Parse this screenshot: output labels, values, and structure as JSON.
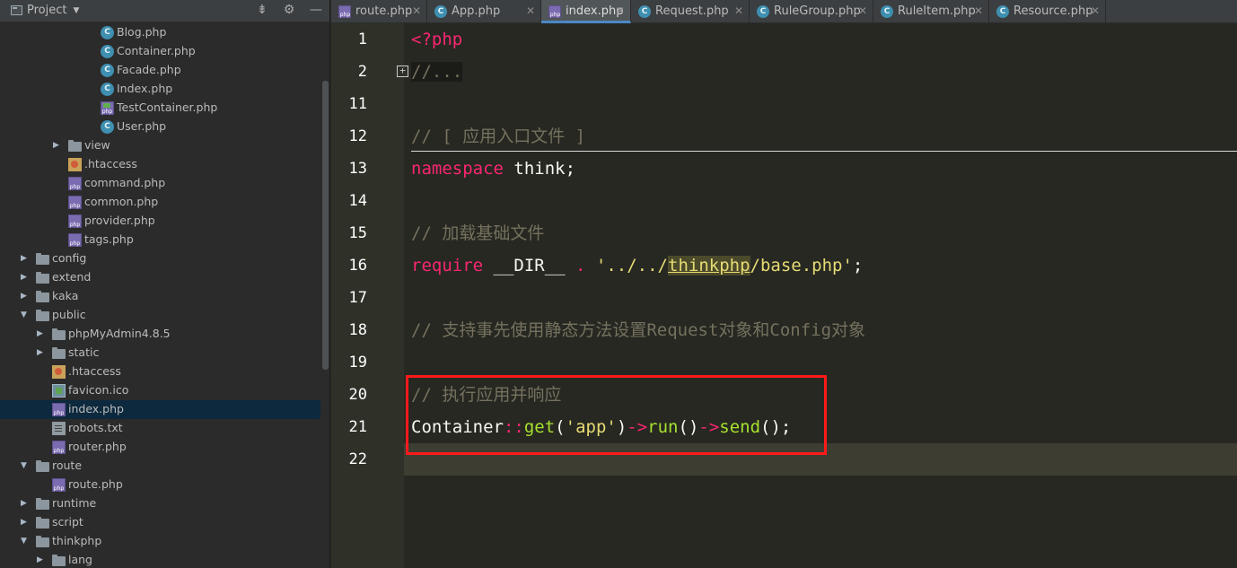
{
  "project_panel": {
    "title": "Project",
    "tree": [
      {
        "label": "Blog.php",
        "icon": "class",
        "depth": 4
      },
      {
        "label": "Container.php",
        "icon": "class",
        "depth": 4
      },
      {
        "label": "Facade.php",
        "icon": "class",
        "depth": 4
      },
      {
        "label": "Index.php",
        "icon": "class",
        "depth": 4
      },
      {
        "label": "TestContainer.php",
        "icon": "test",
        "depth": 4
      },
      {
        "label": "User.php",
        "icon": "class",
        "depth": 4
      },
      {
        "label": "view",
        "icon": "folder",
        "depth": 2,
        "arrow": "collapsed"
      },
      {
        "label": ".htaccess",
        "icon": "htaccess",
        "depth": 2
      },
      {
        "label": "command.php",
        "icon": "php",
        "depth": 2
      },
      {
        "label": "common.php",
        "icon": "php",
        "depth": 2
      },
      {
        "label": "provider.php",
        "icon": "php",
        "depth": 2
      },
      {
        "label": "tags.php",
        "icon": "php",
        "depth": 2
      },
      {
        "label": "config",
        "icon": "folder",
        "depth": 0,
        "arrow": "collapsed"
      },
      {
        "label": "extend",
        "icon": "folder",
        "depth": 0,
        "arrow": "collapsed"
      },
      {
        "label": "kaka",
        "icon": "folder",
        "depth": 0,
        "arrow": "collapsed"
      },
      {
        "label": "public",
        "icon": "folder",
        "depth": 0,
        "arrow": "expanded"
      },
      {
        "label": "phpMyAdmin4.8.5",
        "icon": "folder",
        "depth": 1,
        "arrow": "collapsed"
      },
      {
        "label": "static",
        "icon": "folder",
        "depth": 1,
        "arrow": "collapsed"
      },
      {
        "label": ".htaccess",
        "icon": "htaccess",
        "depth": 1
      },
      {
        "label": "favicon.ico",
        "icon": "ico",
        "depth": 1
      },
      {
        "label": "index.php",
        "icon": "php",
        "depth": 1,
        "selected": true
      },
      {
        "label": "robots.txt",
        "icon": "txt",
        "depth": 1
      },
      {
        "label": "router.php",
        "icon": "php",
        "depth": 1
      },
      {
        "label": "route",
        "icon": "folder",
        "depth": 0,
        "arrow": "expanded"
      },
      {
        "label": "route.php",
        "icon": "php",
        "depth": 1
      },
      {
        "label": "runtime",
        "icon": "folder",
        "depth": 0,
        "arrow": "collapsed"
      },
      {
        "label": "script",
        "icon": "folder",
        "depth": 0,
        "arrow": "collapsed"
      },
      {
        "label": "thinkphp",
        "icon": "folder",
        "depth": 0,
        "arrow": "expanded"
      },
      {
        "label": "lang",
        "icon": "folder",
        "depth": 1,
        "arrow": "collapsed"
      }
    ]
  },
  "tabs": [
    {
      "label": "route.php",
      "icon": "php",
      "active": false
    },
    {
      "label": "App.php",
      "icon": "class",
      "active": false
    },
    {
      "label": "index.php",
      "icon": "php",
      "active": true
    },
    {
      "label": "Request.php",
      "icon": "class",
      "active": false
    },
    {
      "label": "RuleGroup.php",
      "icon": "class",
      "active": false
    },
    {
      "label": "RuleItem.php",
      "icon": "class",
      "active": false
    },
    {
      "label": "Resource.php",
      "icon": "class",
      "active": false
    }
  ],
  "editor": {
    "line_numbers": [
      "1",
      "2",
      "11",
      "12",
      "13",
      "14",
      "15",
      "16",
      "17",
      "18",
      "19",
      "20",
      "21",
      "22"
    ],
    "current_line": "22",
    "code": [
      [
        {
          "t": "<?php",
          "c": "kw"
        }
      ],
      [
        {
          "t": "//...",
          "c": "fold-text"
        }
      ],
      [],
      [
        {
          "t": "// [ 应用入口文件 ]",
          "c": "cm"
        }
      ],
      [
        {
          "t": "namespace",
          "c": "kw"
        },
        {
          "t": " think;",
          "c": "plain"
        }
      ],
      [],
      [
        {
          "t": "// 加载基础文件",
          "c": "cm"
        }
      ],
      [
        {
          "t": "require",
          "c": "kw"
        },
        {
          "t": " __DIR__ ",
          "c": "plain"
        },
        {
          "t": ".",
          "c": "op"
        },
        {
          "t": " '../../",
          "c": "str"
        },
        {
          "t": "thinkphp",
          "c": "hl-word"
        },
        {
          "t": "/base.php'",
          "c": "str"
        },
        {
          "t": ";",
          "c": "plain"
        }
      ],
      [],
      [
        {
          "t": "// 支持事先使用静态方法设置Request对象和Config对象",
          "c": "cm"
        }
      ],
      [],
      [
        {
          "t": "// 执行应用并响应",
          "c": "cm"
        }
      ],
      [
        {
          "t": "Container",
          "c": "plain"
        },
        {
          "t": "::",
          "c": "op"
        },
        {
          "t": "get",
          "c": "fn"
        },
        {
          "t": "(",
          "c": "plain"
        },
        {
          "t": "'app'",
          "c": "str"
        },
        {
          "t": ")",
          "c": "plain"
        },
        {
          "t": "->",
          "c": "op"
        },
        {
          "t": "run",
          "c": "fn"
        },
        {
          "t": "()",
          "c": "plain"
        },
        {
          "t": "->",
          "c": "op"
        },
        {
          "t": "send",
          "c": "fn"
        },
        {
          "t": "();",
          "c": "plain"
        }
      ],
      []
    ]
  },
  "icons": {
    "header_tools": [
      "collapse-all-icon",
      "gear-icon",
      "minimize-icon"
    ],
    "close": "close-icon"
  },
  "colors": {
    "highlight_box": "#ff1a1a",
    "active_tab_underline": "#4a88c7",
    "selection": "#0d293e"
  }
}
